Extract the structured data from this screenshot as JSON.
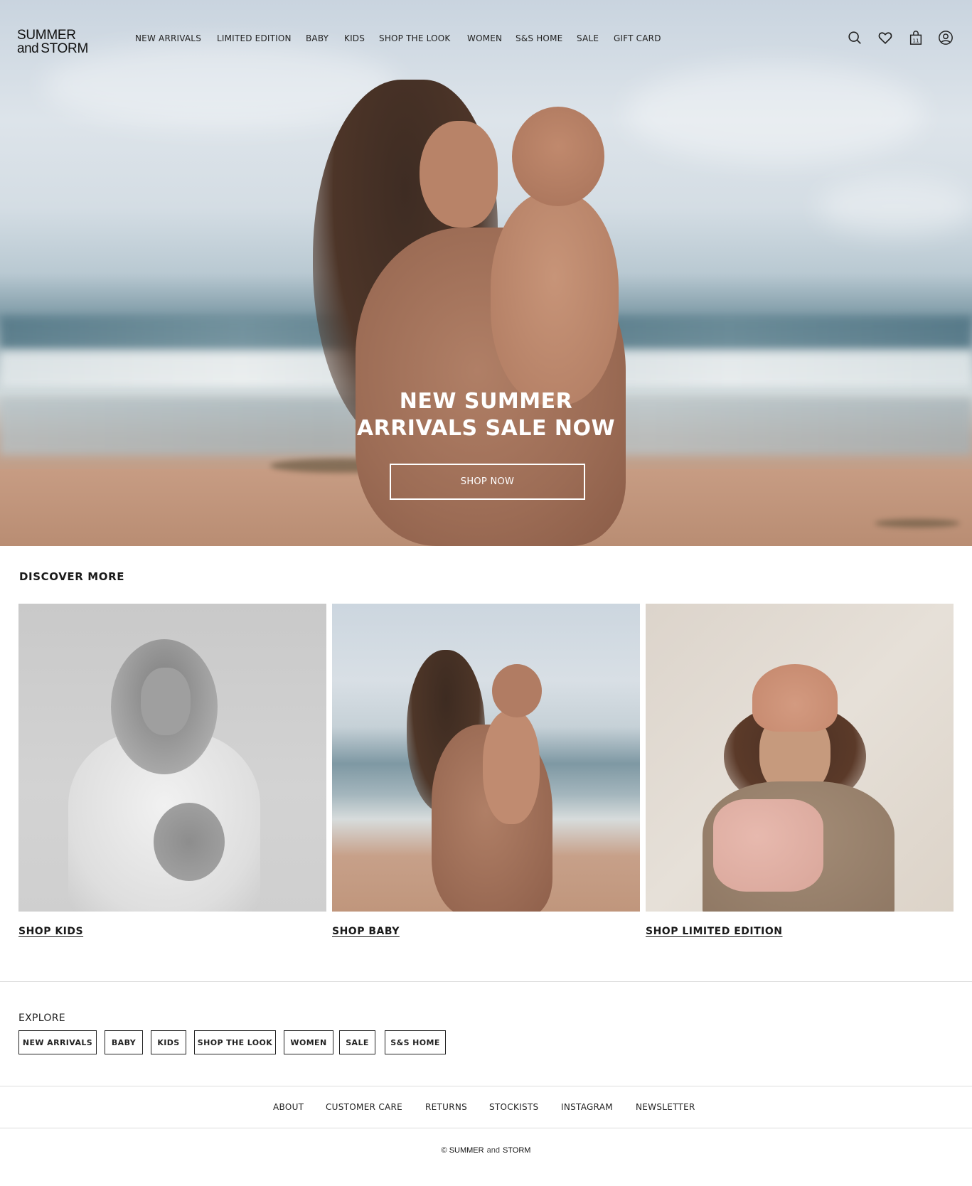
{
  "brand": {
    "line1": "SUMMER",
    "and": "and",
    "line2": "STORM"
  },
  "nav": {
    "items": [
      {
        "label": "NEW ARRIVALS"
      },
      {
        "label": "LIMITED EDITION"
      },
      {
        "label": "BABY"
      },
      {
        "label": "KIDS"
      },
      {
        "label": "SHOP THE LOOK"
      },
      {
        "label": "WOMEN"
      },
      {
        "label": "S&S HOME"
      },
      {
        "label": "SALE"
      },
      {
        "label": "GIFT CARD"
      }
    ]
  },
  "header_icons": {
    "search": "search-icon",
    "wishlist": "heart-icon",
    "cart": "shopping-bag-icon",
    "cart_count": "11",
    "account": "user-icon"
  },
  "hero": {
    "title_line1": "NEW SUMMER",
    "title_line2": "ARRIVALS SALE NOW",
    "cta": "SHOP NOW"
  },
  "discover": {
    "title": "DISCOVER MORE",
    "cards": [
      {
        "label": "SHOP KIDS"
      },
      {
        "label": "SHOP BABY"
      },
      {
        "label": "SHOP LIMITED EDITION"
      }
    ]
  },
  "explore": {
    "title": "EXPLORE",
    "pills": [
      {
        "label": "NEW ARRIVALS"
      },
      {
        "label": "BABY"
      },
      {
        "label": "KIDS"
      },
      {
        "label": "SHOP THE LOOK"
      },
      {
        "label": "WOMEN"
      },
      {
        "label": "SALE"
      },
      {
        "label": "S&S HOME"
      }
    ]
  },
  "footer": {
    "links": [
      {
        "label": "ABOUT"
      },
      {
        "label": "CUSTOMER CARE"
      },
      {
        "label": "RETURNS"
      },
      {
        "label": "STOCKISTS"
      },
      {
        "label": "INSTAGRAM"
      },
      {
        "label": "NEWSLETTER"
      }
    ],
    "copyright_symbol": "©",
    "copyright_brand1": "SUMMER",
    "copyright_and": "and",
    "copyright_brand2": "STORM"
  },
  "colors": {
    "text": "#1a1a1a",
    "background": "#ffffff",
    "hero_text": "#ffffff",
    "divider": "#dddddd"
  }
}
